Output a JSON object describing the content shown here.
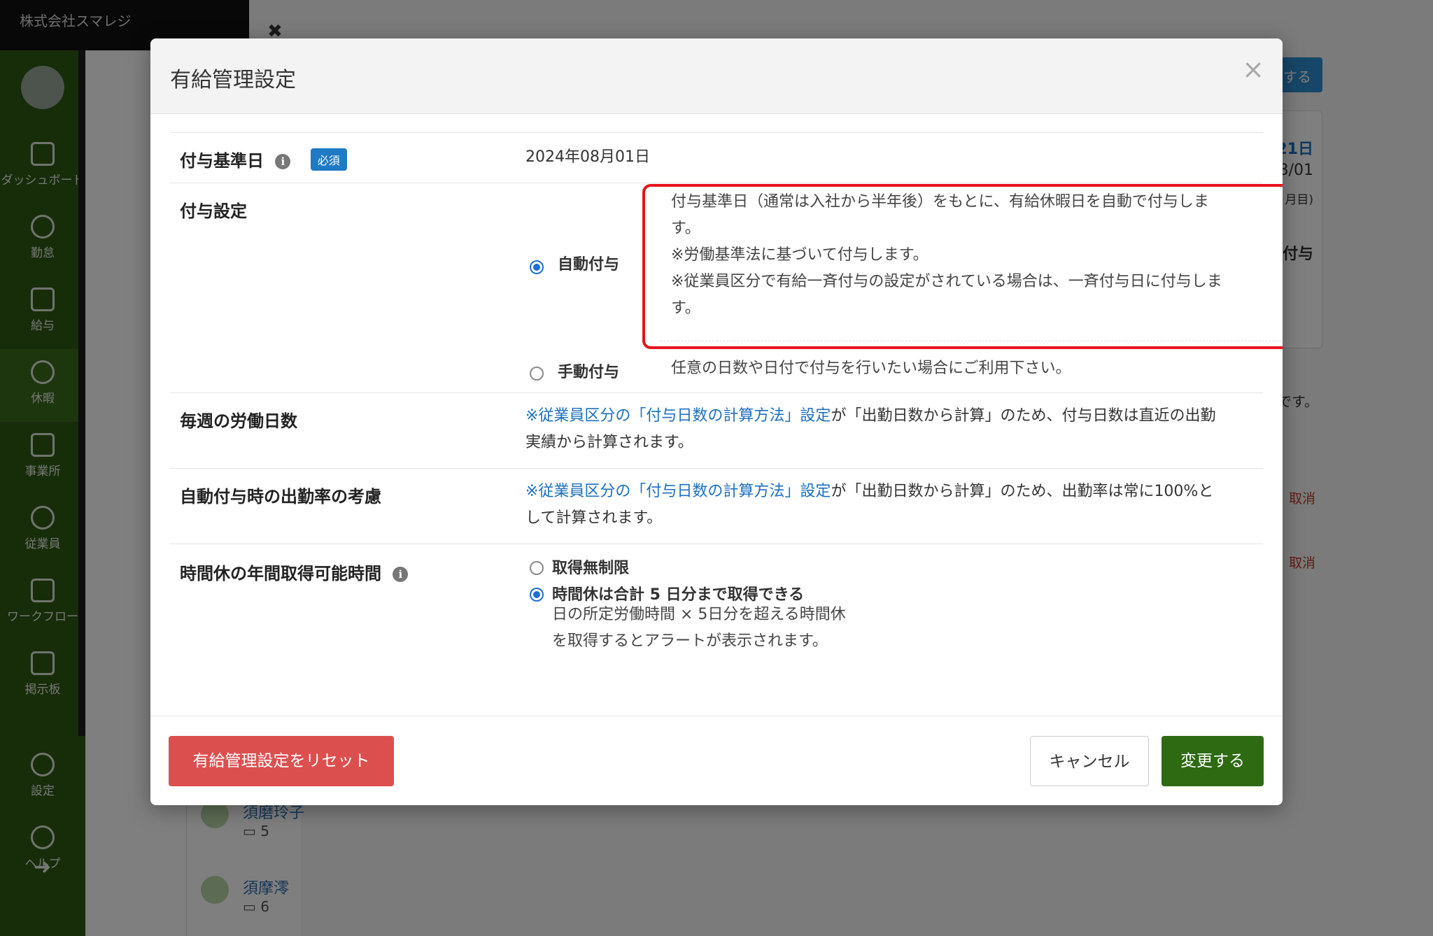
{
  "app": {
    "company": "株式会社スマレジ",
    "sidebar": [
      {
        "label": "ダッシュボード",
        "icon": "dashboard-icon"
      },
      {
        "label": "勤怠",
        "icon": "clock-icon"
      },
      {
        "label": "給与",
        "icon": "calculator-icon"
      },
      {
        "label": "休暇",
        "icon": "umbrella-icon"
      },
      {
        "label": "事業所",
        "icon": "home-icon"
      },
      {
        "label": "従業員",
        "icon": "person-icon"
      },
      {
        "label": "ワークフロー",
        "icon": "workflow-icon"
      },
      {
        "label": "掲示板",
        "icon": "board-icon"
      },
      {
        "label": "設定",
        "icon": "gear-icon"
      },
      {
        "label": "ヘルプ",
        "icon": "help-icon"
      }
    ],
    "background": {
      "button_label": "する",
      "card_lines": [
        "21日",
        "3/01",
        "月目)",
        "付与"
      ],
      "note_text": "です。",
      "cancel_links": [
        "取消",
        "取消"
      ],
      "people": [
        {
          "name": "須磨玲子",
          "num": "5"
        },
        {
          "name": "須摩澪",
          "num": "6"
        }
      ]
    }
  },
  "modal": {
    "title": "有給管理設定",
    "close": "×",
    "grant_date": {
      "label": "付与基準日",
      "badge": "必須",
      "value": "2024年08月01日"
    },
    "grant_setting": {
      "label": "付与設定",
      "auto": {
        "label": "自動付与",
        "desc1": "付与基準日（通常は入社から半年後）をもとに、有給休暇日を自動で付与しま",
        "desc1b": "す。",
        "desc2": "※労働基準法に基づいて付与します。",
        "desc3": "※従業員区分で有給一斉付与の設定がされている場合は、一斉付与日に付与しま",
        "desc3b": "す。"
      },
      "manual": {
        "label": "手動付与",
        "desc": "任意の日数や日付で付与を行いたい場合にご利用下さい。"
      }
    },
    "weekly_days": {
      "label": "毎週の労働日数",
      "link": "※従業員区分の「付与日数の計算方法」設定",
      "text1": "が「出勤日数から計算」のため、付与日数は直近の出勤",
      "text2": "実績から計算されます。"
    },
    "attendance_rate": {
      "label": "自動付与時の出勤率の考慮",
      "link": "※従業員区分の「付与日数の計算方法」設定",
      "text1": "が「出勤日数から計算」のため、出勤率は常に100%と",
      "text2": "して計算されます。"
    },
    "hourly_leave": {
      "label": "時間休の年間取得可能時間",
      "unlimited": "取得無制限",
      "limited": "時間休は合計 5 日分まで取得できる",
      "note1": "日の所定労働時間 × 5日分を超える時間休",
      "note2": "を取得するとアラートが表示されます。"
    },
    "footer": {
      "reset": "有給管理設定をリセット",
      "cancel": "キャンセル",
      "submit": "変更する"
    }
  }
}
